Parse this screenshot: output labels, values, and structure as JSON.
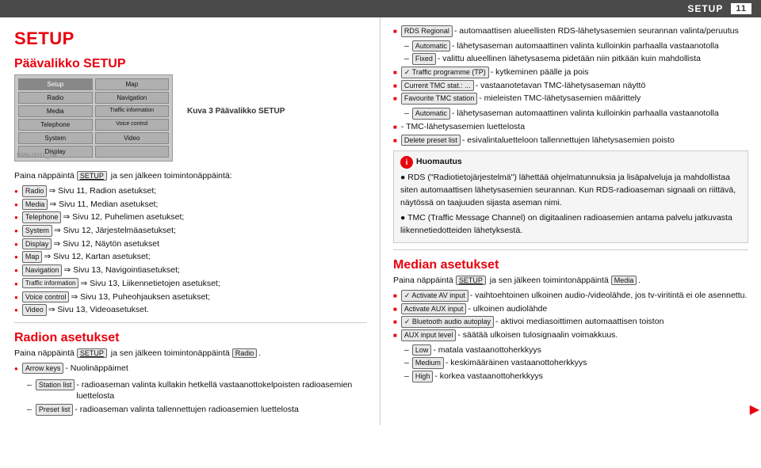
{
  "header": {
    "title": "SETUP",
    "page_number": "11"
  },
  "left": {
    "page_title": "SETUP",
    "section1_title": "Päävalikko SETUP",
    "screenshot_caption": "Kuva 3  Päävalikko SETUP",
    "brn_label": "BRN-0011_20",
    "intro_text": "Paina näppäintä SETUP ja sen jälkeen toimintonäppäintä:",
    "menu_items": [
      {
        "badge": "Radio",
        "text": "⇒ Sivu 11, Radion asetukset;"
      },
      {
        "badge": "Media",
        "text": "⇒ Sivu 11, Median asetukset;"
      },
      {
        "badge": "Telephone",
        "text": "⇒ Sivu 12, Puhelimen asetukset;"
      },
      {
        "badge": "System",
        "text": "⇒ Sivu 12, Järjestelmäasetukset;"
      },
      {
        "badge": "Display",
        "text": "⇒ Sivu 12, Näytön asetukset"
      },
      {
        "badge": "Map",
        "text": "⇒ Sivu 12, Kartan asetukset;"
      },
      {
        "badge": "Navigation",
        "text": "⇒ Sivu 13, Navigointiasetukset;"
      },
      {
        "badge": "Traffic information",
        "text": "⇒ Sivu 13, Liikennetietojen asetukset;"
      },
      {
        "badge": "Voice control",
        "text": "⇒ Sivu 13, Puheohjauksen asetukset;"
      },
      {
        "badge": "Video",
        "text": "⇒ Sivu 13, Videoasetukset."
      }
    ],
    "section2_title": "Radion asetukset",
    "radio_intro": "Paina näppäintä SETUP ja sen jälkeen toimintonäppäintä Radio.",
    "radio_items": [
      {
        "badge": "Arrow keys",
        "text": "- Nuolinäppäimet",
        "sub": [
          {
            "badge": "Station list",
            "text": "- radioaseman valinta kullakin hetkellä vastaanottokelpoisten radioasemien luettelosta"
          },
          {
            "badge": "Preset list",
            "text": "- radioaseman valinta tallennettujen radioasemien luettelosta"
          }
        ]
      }
    ],
    "screen_buttons": [
      [
        "Setup",
        "Map"
      ],
      [
        "Radio",
        "Navigation"
      ],
      [
        "Media",
        "Traffic information"
      ],
      [
        "Telephone",
        "Voice control"
      ],
      [
        "System",
        "Video"
      ],
      [
        "Display",
        ""
      ]
    ]
  },
  "right": {
    "rds_items": [
      {
        "badge": "RDS Regional",
        "text": "- automaattisen alueellisten RDS-lähetysasemien seurannan valinta/peruutus",
        "sub": [
          {
            "badge": "Automatic",
            "text": "- lähetysaseman automaattinen valinta kulloinkin parhaalla vastaanotolla"
          },
          {
            "badge": "Fixed",
            "text": "- valittu alueellinen lähetysasema pidetään niin pitkään kuin mahdollista"
          }
        ]
      },
      {
        "badge": "✓ Traffic programme (TP)",
        "text": "- kytkeminen päälle ja pois"
      },
      {
        "badge": "Current TMC stat.:",
        "text": "- vastaanotetavan TMC-lähetysaseman näyttö"
      },
      {
        "badge": "Favourite TMC station",
        "text": "- mieleisten TMC-lähetysasemien määrittely",
        "sub": [
          {
            "badge": "Automatic",
            "text": "- lähetysaseman automaattinen valinta kulloinkin parhaalla vastaanotolla"
          }
        ]
      },
      {
        "badge": null,
        "text": "- TMC-lähetysasemien luettelosta"
      },
      {
        "badge": "Delete preset list",
        "text": "- esivalintaluetteloon tallennettujen lähetysasemien poisto"
      }
    ],
    "note": {
      "header": "Huomautus",
      "items": [
        "RDS (\"Radiotietojärjestelmä\") lähettää ohjelmatunnuksia ja lisäpalveluja ja mahdollistaa siten automaattisen lähetysasemien seurannan. Kun RDS-radioaseman signaali on riittävä, näytössä on taajuuden sijasta aseman nimi.",
        "TMC (Traffic Message Channel) on digitaalinen radioasemien antama palvelu jatkuvasta liikennetiedotteiden lähetyksestä."
      ]
    },
    "section_title": "Median asetukset",
    "media_intro": "Paina näppäintä SETUP ja sen jälkeen toimintonäppäintä Media.",
    "media_items": [
      {
        "badge": "✓ Activate AV input",
        "text": "- vaihtoehtoinen ulkoinen audio-/videolähde, jos tv-viritintä ei ole asennettu."
      },
      {
        "badge": "Activate AUX input",
        "text": "- ulkoinen audiolähde"
      },
      {
        "badge": "✓ Bluetooth audio autoplay",
        "text": "- aktivoi mediasoittimen automaattisen toiston"
      },
      {
        "badge": "AUX input level",
        "text": "- säätää ulkoisen tulosignaalin voimakkuus.",
        "sub": [
          {
            "badge": "Low",
            "text": "- matala vastaanottoherkkyys"
          },
          {
            "badge": "Medium",
            "text": "- keskimääräinen vastaanottoherkkyys"
          },
          {
            "badge": "High",
            "text": "- korkea vastaanottoherkkyys"
          }
        ]
      }
    ]
  }
}
